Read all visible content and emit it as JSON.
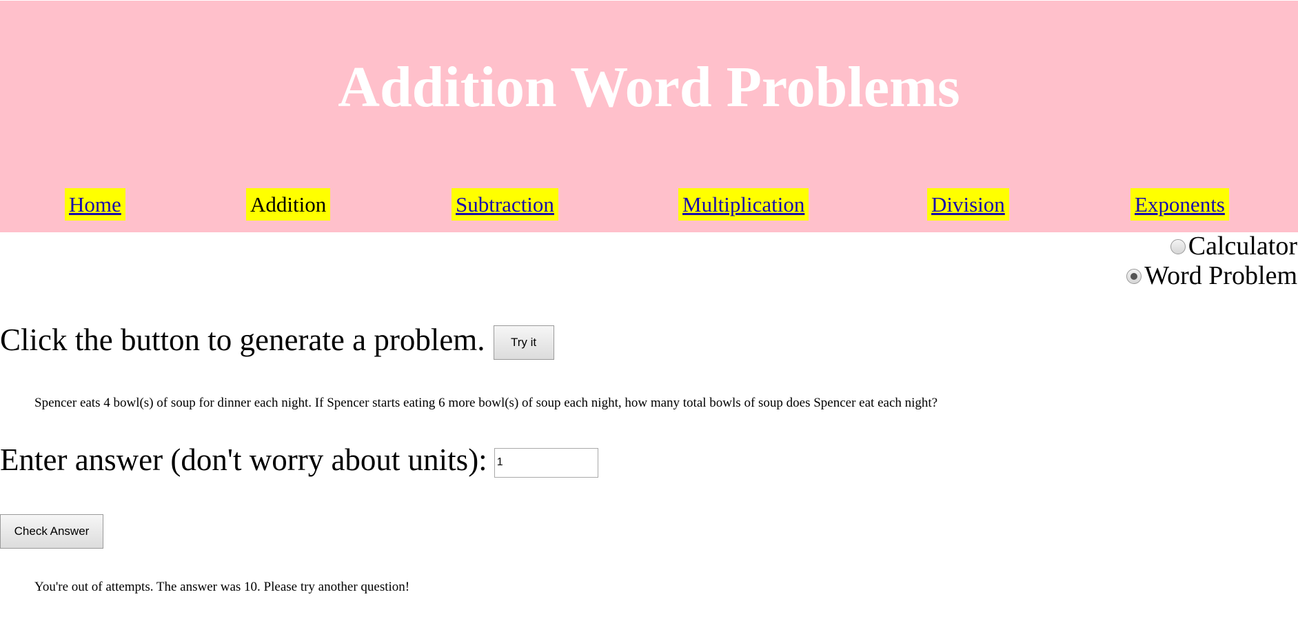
{
  "header": {
    "title": "Addition Word Problems",
    "background_color": "#ffc0cb",
    "nav_highlight_color": "#ffff00"
  },
  "nav": {
    "items": [
      {
        "label": "Home",
        "is_link": true
      },
      {
        "label": "Addition",
        "is_link": false
      },
      {
        "label": "Subtraction",
        "is_link": true
      },
      {
        "label": "Multiplication",
        "is_link": true
      },
      {
        "label": "Division",
        "is_link": true
      },
      {
        "label": "Exponents",
        "is_link": true
      }
    ]
  },
  "mode": {
    "options": [
      {
        "label": "Calculator",
        "selected": false
      },
      {
        "label": "Word Problem",
        "selected": true
      }
    ]
  },
  "generator": {
    "prompt": "Click the button to generate a problem.",
    "button_label": "Try it",
    "problem_text": "Spencer eats 4 bowl(s) of soup for dinner each night. If Spencer starts eating 6 more bowl(s) of soup each night, how many total bowls of soup does Spencer eat each night?"
  },
  "answer": {
    "label": "Enter answer (don't worry about units):",
    "value": "1",
    "check_button_label": "Check Answer",
    "result_text": "You're out of attempts. The answer was 10. Please try another question!"
  }
}
